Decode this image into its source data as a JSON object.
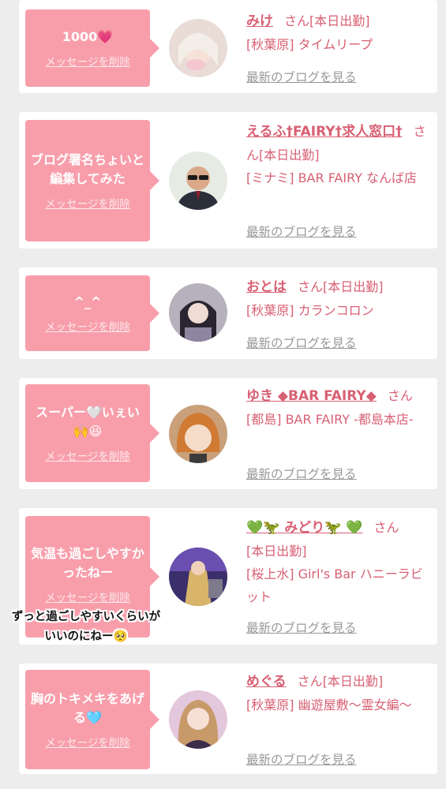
{
  "delete_label": "メッセージを削除",
  "blog_label": "最新のブログを見る",
  "san": "さん",
  "cards": [
    {
      "message": "1000💗",
      "name": "みけ",
      "status": "[本日出勤]",
      "shop": "[秋葉原] タイムリープ"
    },
    {
      "message": "ブログ署名ちょいと編集してみた",
      "name": "えるふ†FAIRY†求人窓口†",
      "status": "[本日出勤]",
      "shop": "[ミナミ] BAR FAIRY なんば店"
    },
    {
      "message": "^_^",
      "name": "おとは",
      "status": "[本日出勤]",
      "shop": "[秋葉原] カランコロン"
    },
    {
      "message": "スーパー🤍いぇい🙌😆",
      "name": "ゆき ◆BAR FAIRY◆",
      "status": "",
      "shop": "[都島] BAR FAIRY -都島本店-"
    },
    {
      "message": "気温も過ごしやすかったねー",
      "name": "💚🦖 みどり🦖 💚",
      "status": "[本日出勤]",
      "shop": "[桜上水] Girl's Bar ハニーラビット"
    },
    {
      "message": "胸のトキメキをあげる🩵",
      "name": "めぐる",
      "status": "[本日出勤]",
      "shop": "[秋葉原] 幽遊屋敷〜霊女編〜"
    }
  ],
  "overlay_text": "ずっと過ごしやすいくらいがいいのにねー🥺",
  "colors": {
    "accent": "#f89eab",
    "name": "#d86073",
    "link_gray": "#999999",
    "background": "#ededed"
  }
}
